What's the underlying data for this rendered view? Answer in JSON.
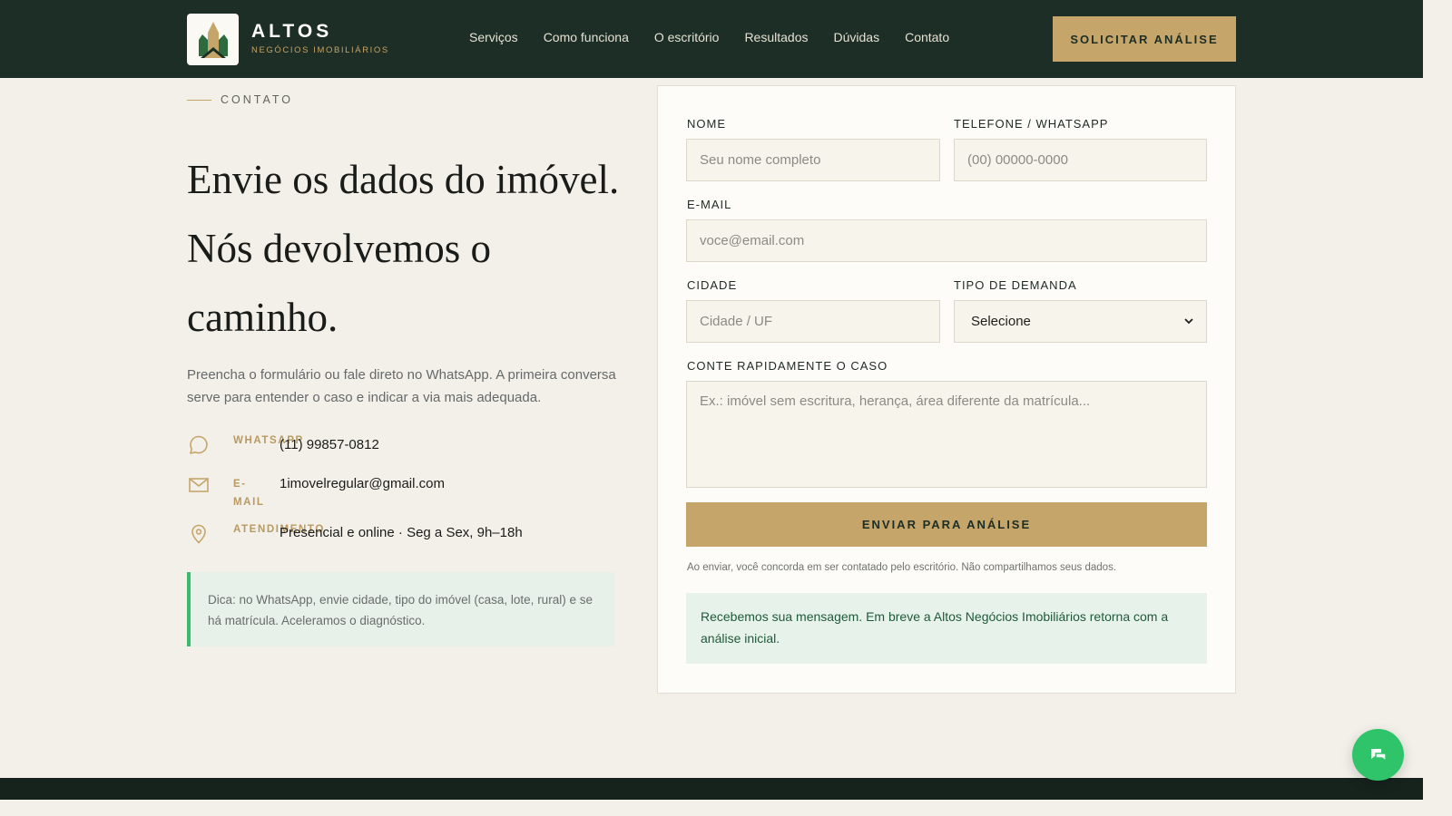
{
  "header": {
    "brand_name": "ALTOS",
    "brand_sub": "NEGÓCIOS IMOBILIÁRIOS",
    "nav": [
      "Serviços",
      "Como funciona",
      "O escritório",
      "Resultados",
      "Dúvidas",
      "Contato"
    ],
    "cta_label": "SOLICITAR ANÁLISE"
  },
  "contact": {
    "eyebrow": "CONTATO",
    "headline": "Envie os dados do imóvel. Nós devolvemos o caminho.",
    "lead": "Preencha o formulário ou fale direto no WhatsApp. A primeira conversa serve para entender o caso e indicar a via mais adequada.",
    "items": [
      {
        "label": "WHATSAPP",
        "value": "(11) 99857-0812",
        "icon": "whatsapp-icon"
      },
      {
        "label": "E-MAIL",
        "value": "1imovelregular@gmail.com",
        "icon": "mail-icon"
      },
      {
        "label": "ATENDIMENTO",
        "value": "Presencial e online · Seg a Sex, 9h–18h",
        "icon": "location-pin-icon"
      }
    ],
    "tip": "Dica: no WhatsApp, envie cidade, tipo do imóvel (casa, lote, rural) e se há matrícula. Aceleramos o diagnóstico."
  },
  "form": {
    "name_label": "NOME",
    "name_placeholder": "Seu nome completo",
    "phone_label": "TELEFONE / WHATSAPP",
    "phone_placeholder": "(00) 00000-0000",
    "email_label": "E-MAIL",
    "email_placeholder": "voce@email.com",
    "city_label": "CIDADE",
    "city_placeholder": "Cidade / UF",
    "demand_label": "TIPO DE DEMANDA",
    "demand_value": "Selecione",
    "case_label": "CONTE RAPIDAMENTE O CASO",
    "case_placeholder": "Ex.: imóvel sem escritura, herança, área diferente da matrícula...",
    "submit_label": "ENVIAR PARA ANÁLISE",
    "disclaimer": "Ao enviar, você concorda em ser contatado pelo escritório. Não compartilhamos seus dados.",
    "success": "Recebemos sua mensagem. Em breve a Altos Negócios Imobiliários retorna com a análise inicial."
  },
  "colors": {
    "header_bg": "#1c2e25",
    "accent_gold": "#c6a56a",
    "page_bg": "#f3f0ea",
    "success_green": "#2fc46a"
  }
}
